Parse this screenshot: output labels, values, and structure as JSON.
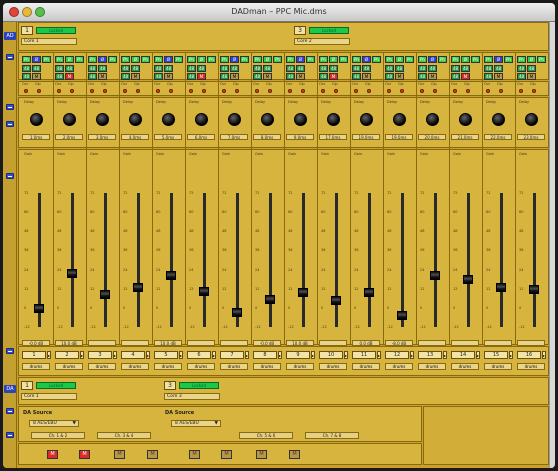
{
  "window": {
    "title": "DADman – PPC Mic.dms"
  },
  "colors": {
    "panel": "#d7b43e",
    "window_bg": "#c9a12a",
    "lock_green": "#1cc84a",
    "mute_red": "#dd2a2a",
    "phantom_green": "#33cc44",
    "phase_blue": "#3344dd",
    "gutter_blue": "#2c43b8"
  },
  "sections": {
    "ad_label": "AD",
    "da_label": "DA"
  },
  "ad": {
    "units": [
      {
        "number": "1",
        "lock": "Locked",
        "name": "Core 1"
      },
      {
        "number": "3",
        "lock": "Locked",
        "name": "Core 2"
      }
    ]
  },
  "button_labels": {
    "phantom": "Ph",
    "phase": "Ø",
    "pad": "48",
    "mute": "M"
  },
  "labels": {
    "ovr": "Ovr",
    "clp": "Clp",
    "delay": "Delay",
    "gain": "Gain"
  },
  "delays": [
    "1.0ms",
    "2.0ms",
    "3.0ms",
    "4.0ms",
    "5.0ms",
    "6.0ms",
    "7.0ms",
    "8.0ms",
    "9.0ms",
    "17.0ms",
    "19.0ms",
    "19.0ms",
    "20.0ms",
    "21.0ms",
    "22.0ms",
    "23.0ms"
  ],
  "gain_ticks": [
    "72",
    "60",
    "48",
    "36",
    "24",
    "12",
    "0",
    "-12"
  ],
  "gains": [
    {
      "value": "-0.0 dB",
      "level": 0.14
    },
    {
      "value": "10.0 dB",
      "level": 0.4
    },
    {
      "value": "",
      "level": 0.25
    },
    {
      "value": "",
      "level": 0.3
    },
    {
      "value": "10.0 dB",
      "level": 0.39
    },
    {
      "value": "",
      "level": 0.27
    },
    {
      "value": "",
      "level": 0.11
    },
    {
      "value": "-0.0 dB",
      "level": 0.21
    },
    {
      "value": "10.0 dB",
      "level": 0.26
    },
    {
      "value": "",
      "level": 0.2
    },
    {
      "value": "0.0 dB",
      "level": 0.26
    },
    {
      "value": "-8.0 dB",
      "level": 0.09
    },
    {
      "value": "",
      "level": 0.39
    },
    {
      "value": "",
      "level": 0.36
    },
    {
      "value": "",
      "level": 0.3
    },
    {
      "value": "",
      "level": 0.28
    }
  ],
  "channels": [
    "1",
    "2",
    "3",
    "4",
    "5",
    "6",
    "7",
    "8",
    "9",
    "10",
    "11",
    "12",
    "13",
    "14",
    "15",
    "16"
  ],
  "channel_names": [
    "drums",
    "drums",
    "drums",
    "drums",
    "drums",
    "drums",
    "drums",
    "drums",
    "drums",
    "drums",
    "drums",
    "drums",
    "drums",
    "drums",
    "drums",
    "drums"
  ],
  "da": {
    "units": [
      {
        "number": "1",
        "lock": "Locked",
        "name": "Core 1",
        "source_label": "DA Source",
        "source_value": "8 AES/EBU",
        "pairs": [
          "Ch. 1 & 2",
          "Ch. 3 & 4"
        ]
      },
      {
        "number": "3",
        "lock": "Locked",
        "name": "Core 3",
        "source_label": "DA Source",
        "source_value": "8 AES/EBU",
        "pairs": [
          "Ch. 5 & 6",
          "Ch. 7 & 8"
        ]
      }
    ]
  }
}
